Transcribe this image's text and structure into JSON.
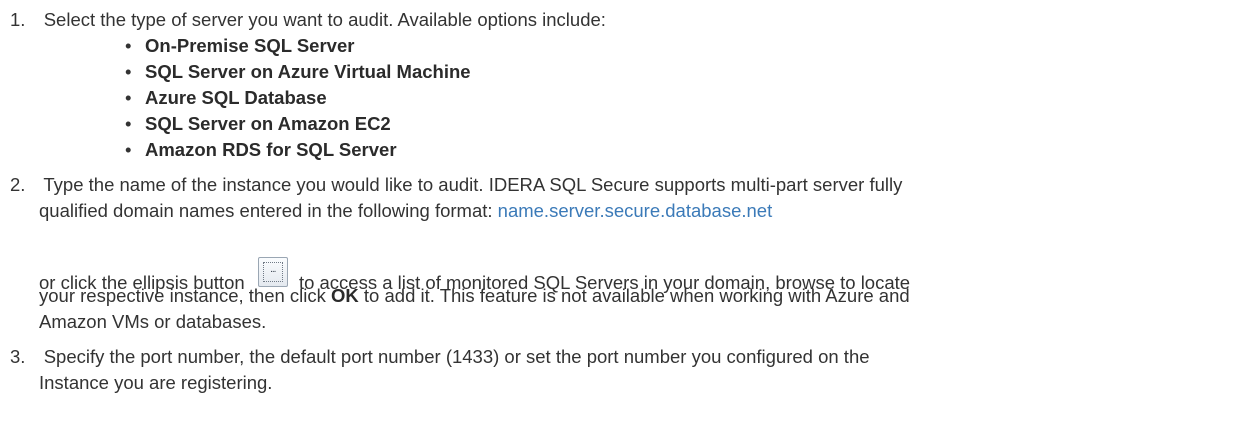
{
  "step1": {
    "number": "1.",
    "text": "Select the type of server you want to audit. Available options include:",
    "options": [
      "On-Premise SQL Server",
      "SQL Server on Azure Virtual Machine",
      "Azure SQL Database",
      "SQL Server on Amazon EC2",
      "Amazon RDS for SQL Server"
    ]
  },
  "step2": {
    "number": "2.",
    "line1": "Type the name of the instance you would like to audit. IDERA SQL Secure supports multi-part server fully",
    "line2_prefix": "qualified domain names entered in the following format: ",
    "format_example": "name.server.secure.database.net",
    "line3_before_button": "or click the ellipsis button",
    "ellipsis_icon_glyph": "...",
    "line3_after_button": "to access a list of monitored SQL Servers in your domain, browse to locate",
    "line4_prefix": "your respective instance, then click ",
    "line4_ok": "OK",
    "line4_suffix": " to add it. This feature is not available when working with Azure and",
    "line5": "Amazon VMs or databases."
  },
  "step3": {
    "number": "3.",
    "line1": "Specify the port number, the default port number (1433) or set the port number you configured on the",
    "line2": "Instance you are registering."
  },
  "colors": {
    "text": "#333333",
    "link": "#3b7ab8"
  }
}
